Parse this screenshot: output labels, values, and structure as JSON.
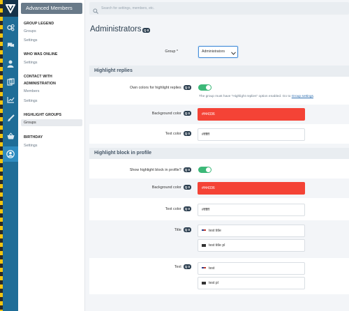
{
  "search": {
    "placeholder": "Search for settings, members, etc."
  },
  "sidebar": {
    "title": "Advanced Members",
    "groups": [
      {
        "heading": "GROUP LEGEND",
        "links": [
          "Groups",
          "Settings"
        ]
      },
      {
        "heading": "WHO WAS ONLINE",
        "links": [
          "Settings"
        ]
      },
      {
        "heading_line1": "CONTACT WITH",
        "heading_line2": "ADMINISTRATION",
        "links": [
          "Members",
          "Settings"
        ]
      },
      {
        "heading": "HIGHLIGHT GROUPS",
        "links": [
          "Groups"
        ],
        "active": "Groups"
      },
      {
        "heading": "BIRTHDAY",
        "links": [
          "Settings"
        ]
      }
    ]
  },
  "page": {
    "title": "Administrators",
    "badge": "Q 0"
  },
  "form": {
    "group_label": "Group *",
    "group_value": "Administrators",
    "highlight_replies": {
      "heading": "Highlight replies",
      "own_colors_label": "Own colors for highlight replies",
      "own_colors_badge": "Q 0",
      "help_text": "The group must have \"Highlight replies\" option enabled. Go to",
      "help_link": "Group settings",
      "bg_label": "Background color",
      "bg_badge": "Q 0",
      "bg_value": "#f44336",
      "text_label": "Text color",
      "text_badge": "Q 0",
      "text_value": "#ffffff"
    },
    "highlight_block": {
      "heading": "Highlight block in profile",
      "show_label": "Show highlight block in profile?",
      "show_badge": "Q 0",
      "bg_label": "Background color",
      "bg_badge": "Q 0",
      "bg_value": "#f44336",
      "text_label": "Text color",
      "text_badge": "Q 0",
      "text_value": "#ffffff",
      "title_label": "Title",
      "title_badge": "Q 0",
      "title_en": "test title",
      "title_pl": "test title pl",
      "text2_label": "Text",
      "text2_badge": "Q 0",
      "text_en": "test",
      "text_pl": "test pl"
    }
  },
  "colors": {
    "accent": "#1f6d97",
    "toggle_on": "#3cb878",
    "highlight_red": "#f44336"
  },
  "icons": [
    "logo-icon",
    "cogs-icon",
    "chat-icon",
    "user-icon",
    "clipboard-icon",
    "chart-icon",
    "brush-icon",
    "basket-icon",
    "profile-icon",
    "search-icon"
  ]
}
